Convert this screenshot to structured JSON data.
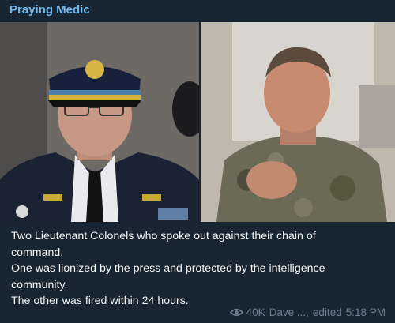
{
  "post": {
    "channel_name": "Praying Medic",
    "caption_lines": [
      "Two Lieutenant Colonels who spoke out against their chain of",
      "command.",
      "One was lionized by the press and protected by the intelligence",
      "community.",
      "The other was fired within 24 hours."
    ],
    "views": "40K",
    "author": "Dave ...,",
    "edited_label": "edited",
    "time": "5:18 PM",
    "icons": {
      "views": "eye-icon"
    },
    "colors": {
      "background": "#182533",
      "channel_name": "#71baf2",
      "meta_text": "#6d7f8f",
      "caption_text": "#f5f5f5"
    }
  }
}
